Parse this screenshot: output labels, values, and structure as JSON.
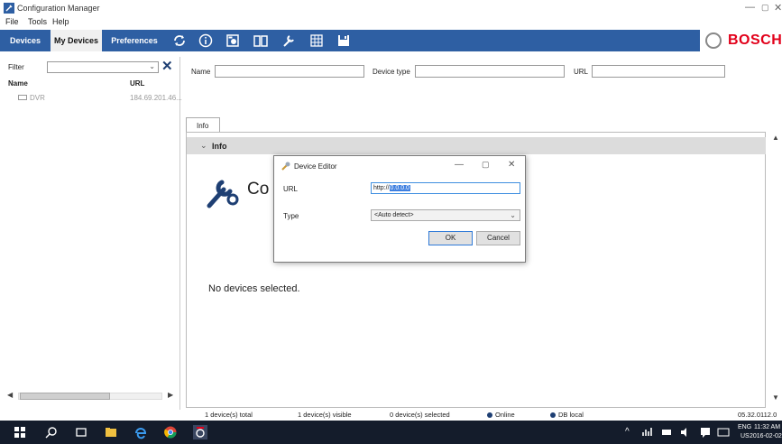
{
  "window": {
    "title": "Configuration Manager",
    "minimize": "—",
    "maximize": "▢",
    "close": "✕"
  },
  "menu": [
    "File",
    "Tools",
    "Help"
  ],
  "toolbar": {
    "tabs": [
      "Devices",
      "My Devices",
      "Preferences"
    ],
    "active_tab": "My Devices",
    "icons": [
      "refresh-icon",
      "info-icon",
      "camera-settings-icon",
      "book-icon",
      "wrench-icon",
      "grid-icon",
      "save-icon"
    ],
    "brand": "BOSCH",
    "brand_color": "#e2001a",
    "bar_color": "#2e5fa3"
  },
  "left": {
    "filter_label": "Filter",
    "filter_value": "",
    "columns": {
      "name": "Name",
      "url": "URL"
    },
    "devices": [
      {
        "name": "DVR",
        "url": "184.69.201.46..."
      }
    ]
  },
  "search": {
    "name_label": "Name",
    "device_type_label": "Device type",
    "url_label": "URL"
  },
  "info": {
    "tab_label": "Info",
    "section_title": "Info",
    "big_title": "Co",
    "empty_message": "No devices selected."
  },
  "dialog": {
    "title": "Device Editor",
    "url_label": "URL",
    "url_prefix": "http://",
    "url_selected": "0.0.0.0",
    "type_label": "Type",
    "type_value": "<Auto detect>",
    "ok": "OK",
    "cancel": "Cancel"
  },
  "status": {
    "total": "1 device(s) total",
    "visible": "1 device(s) visible",
    "selected": "0 device(s) selected",
    "online": "Online",
    "db": "DB local",
    "version": "05.32.0112.0"
  },
  "taskbar": {
    "lang1": "ENG",
    "lang2": "US",
    "time": "11:32 AM",
    "date": "2016-02-02"
  }
}
